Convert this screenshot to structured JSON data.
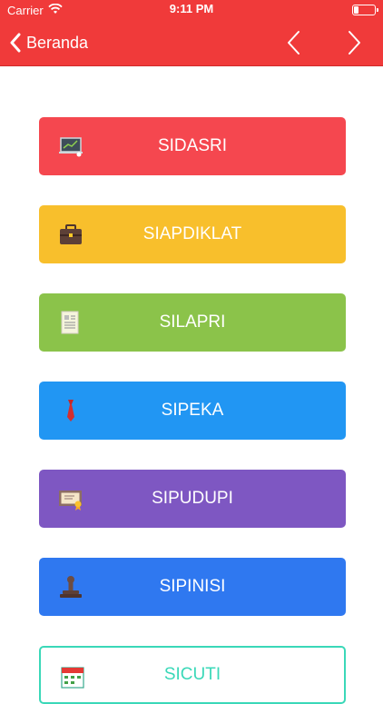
{
  "status_bar": {
    "carrier": "Carrier",
    "time": "9:11 PM",
    "battery_level": 0.25
  },
  "nav": {
    "back_label": "Beranda",
    "prev_icon": "chevron-left-icon",
    "next_icon": "chevron-right-icon",
    "background_color": "#f03a3a"
  },
  "menu": {
    "items": [
      {
        "label": "SIDASRI",
        "color": "#f5474f",
        "icon": "presentation-board-icon"
      },
      {
        "label": "SIAPDIKLAT",
        "color": "#f8bf2c",
        "icon": "briefcase-icon"
      },
      {
        "label": "SILAPRI",
        "color": "#8bc34a",
        "icon": "document-report-icon"
      },
      {
        "label": "SIPEKA",
        "color": "#2196f3",
        "icon": "necktie-icon"
      },
      {
        "label": "SIPUDUPI",
        "color": "#7e57c2",
        "icon": "certificate-icon"
      },
      {
        "label": "SIPINISI",
        "color": "#2f78f0",
        "icon": "stamp-icon"
      },
      {
        "label": "SICUTI",
        "color": "#3ad8b8",
        "icon": "calendar-icon"
      }
    ]
  }
}
